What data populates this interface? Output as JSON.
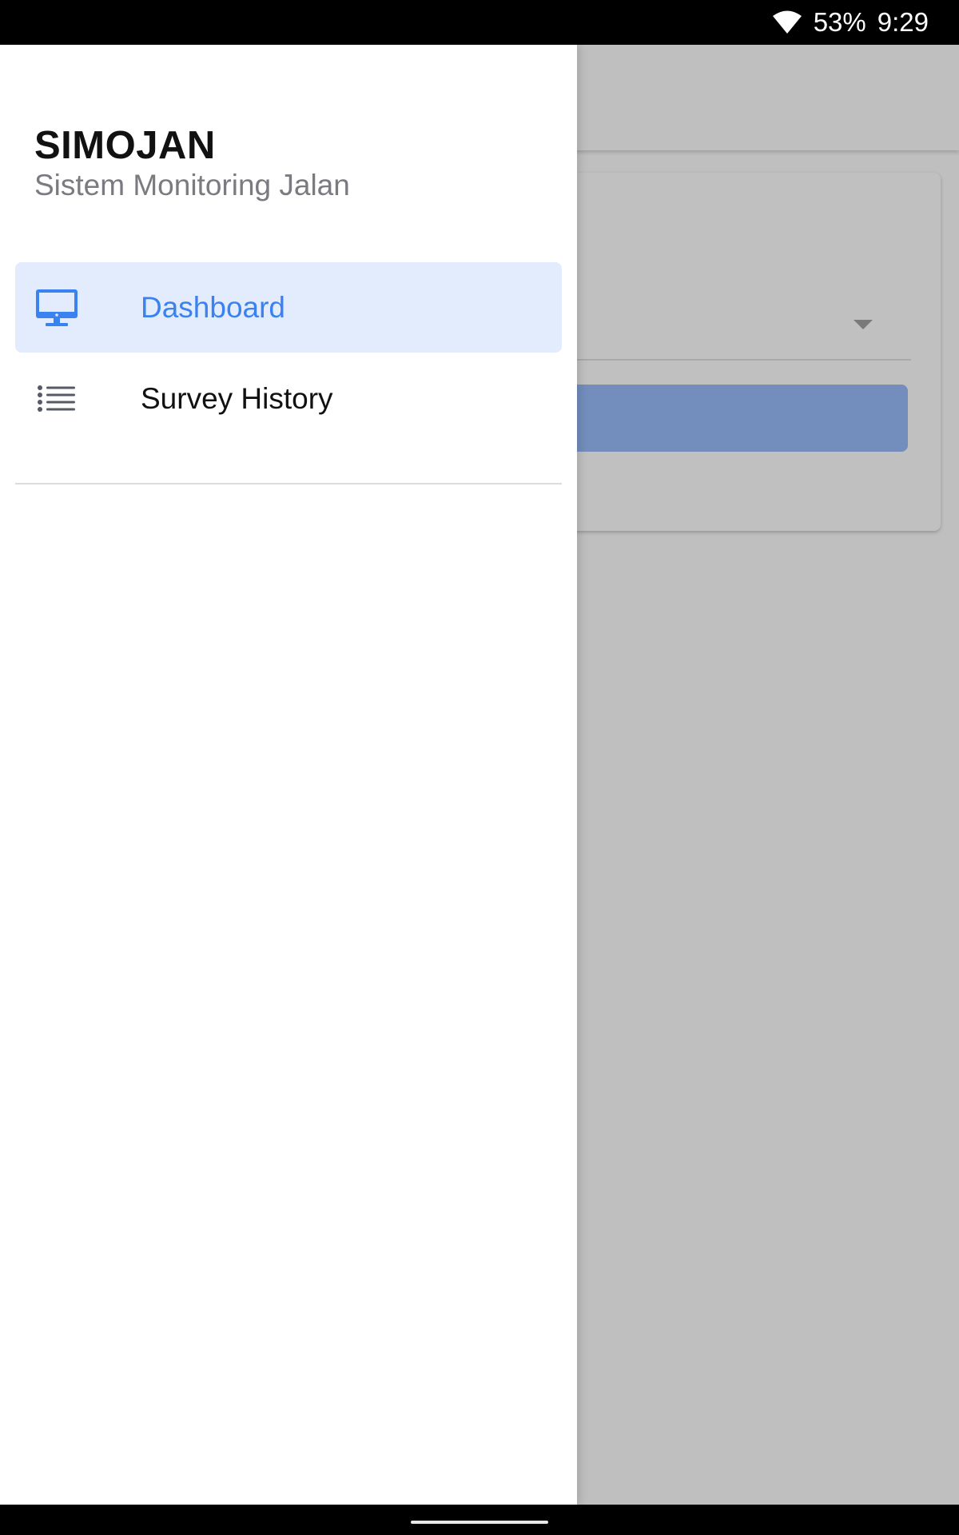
{
  "status_bar": {
    "battery": "53%",
    "time": "9:29",
    "wifi_icon": "wifi-icon"
  },
  "drawer": {
    "title": "SIMOJAN",
    "subtitle": "Sistem Monitoring Jalan",
    "items": [
      {
        "label": "Dashboard",
        "icon": "desktop-monitor-icon",
        "active": true
      },
      {
        "label": "Survey History",
        "icon": "list-icon",
        "active": false
      }
    ]
  },
  "colors": {
    "accent": "#3a82f0",
    "active_item_bg": "#e2ecfd",
    "scrim": "#bfbfbf",
    "background_button": "#738dbd"
  }
}
